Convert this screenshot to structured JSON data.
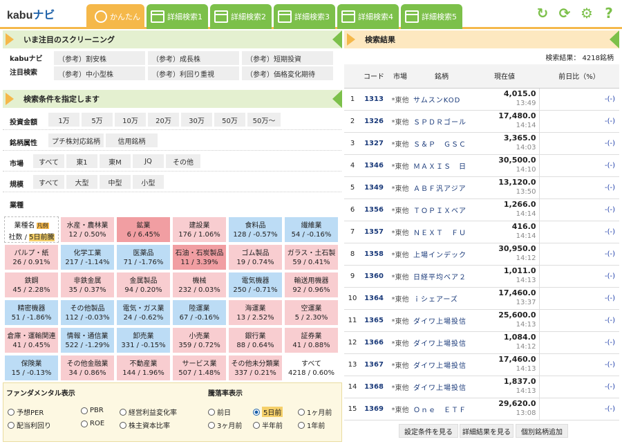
{
  "app": {
    "logo_a": "kabu",
    "logo_b": "ナビ"
  },
  "tabs": [
    {
      "label": "かんたん"
    },
    {
      "label": "詳細検索1"
    },
    {
      "label": "詳細検索2"
    },
    {
      "label": "詳細検索3"
    },
    {
      "label": "詳細検索4"
    },
    {
      "label": "詳細検索5"
    }
  ],
  "top_icons": [
    "reload-icon",
    "refresh-icon",
    "gear-icon",
    "help-icon"
  ],
  "screening": {
    "title": "いま注目のスクリーニング",
    "label1": "kabuナビ",
    "label2": "注目検索",
    "items": [
      "（参考）割安株",
      "（参考）成長株",
      "（参考）短期投資",
      "（参考）中小型株",
      "（参考）利回り重視",
      "（参考）価格変化期待"
    ]
  },
  "conditions": {
    "title": "検索条件を指定します",
    "amount_label": "投資金額",
    "amounts": [
      "1万",
      "5万",
      "10万",
      "20万",
      "30万",
      "50万",
      "50万〜"
    ],
    "attr_label": "銘柄属性",
    "attrs": [
      "プチ株対応銘柄",
      "信用銘柄"
    ],
    "market_label": "市場",
    "markets": [
      "すべて",
      "東1",
      "東M",
      "JQ",
      "その他"
    ],
    "scale_label": "規模",
    "scales": [
      "すべて",
      "大型",
      "中型",
      "小型"
    ],
    "industry_label": "業種",
    "legend": {
      "name": "業種名",
      "badge": "凡例",
      "count": "社数",
      "period": "5日前騰"
    },
    "industries": [
      {
        "name": "水産・農林業",
        "value": "12 / 0.50%",
        "color": "pk"
      },
      {
        "name": "鉱業",
        "value": "6 / 6.45%",
        "color": "dpk"
      },
      {
        "name": "建設業",
        "value": "176 / 1.06%",
        "color": "pk"
      },
      {
        "name": "食料品",
        "value": "128 / -0.57%",
        "color": "bl"
      },
      {
        "name": "繊維業",
        "value": "54 / -0.16%",
        "color": "bl"
      },
      {
        "name": "パルプ・紙",
        "value": "26 / 0.91%",
        "color": "pk"
      },
      {
        "name": "化学工業",
        "value": "217 / -1.14%",
        "color": "bl"
      },
      {
        "name": "医薬品",
        "value": "71 / -1.76%",
        "color": "bl"
      },
      {
        "name": "石油・石炭製品",
        "value": "11 / 3.39%",
        "color": "dpk"
      },
      {
        "name": "ゴム製品",
        "value": "19 / 0.74%",
        "color": "pk"
      },
      {
        "name": "ガラス・土石製",
        "value": "59 / 0.41%",
        "color": "pk"
      },
      {
        "name": "鉄鋼",
        "value": "45 / 2.28%",
        "color": "pk"
      },
      {
        "name": "非鉄金属",
        "value": "35 / 0.37%",
        "color": "pk"
      },
      {
        "name": "金属製品",
        "value": "94 / 0.20%",
        "color": "pk"
      },
      {
        "name": "機械",
        "value": "232 / 0.03%",
        "color": "pk"
      },
      {
        "name": "電気機器",
        "value": "250 / -0.71%",
        "color": "bl"
      },
      {
        "name": "輸送用機器",
        "value": "92 / 0.96%",
        "color": "pk"
      },
      {
        "name": "精密機器",
        "value": "51 / -1.86%",
        "color": "bl"
      },
      {
        "name": "その他製品",
        "value": "112 / -0.03%",
        "color": "bl"
      },
      {
        "name": "電気・ガス業",
        "value": "24 / -0.62%",
        "color": "bl"
      },
      {
        "name": "陸運業",
        "value": "67 / -0.16%",
        "color": "bl"
      },
      {
        "name": "海運業",
        "value": "13 / 2.52%",
        "color": "pk"
      },
      {
        "name": "空運業",
        "value": "5 / 2.30%",
        "color": "pk"
      },
      {
        "name": "倉庫・運輸関連",
        "value": "41 / 0.45%",
        "color": "pk"
      },
      {
        "name": "情報・通信業",
        "value": "522 / -1.29%",
        "color": "bl"
      },
      {
        "name": "卸売業",
        "value": "331 / -0.15%",
        "color": "bl"
      },
      {
        "name": "小売業",
        "value": "359 / 0.72%",
        "color": "pk"
      },
      {
        "name": "銀行業",
        "value": "88 / 0.64%",
        "color": "pk"
      },
      {
        "name": "証券業",
        "value": "41 / 0.88%",
        "color": "pk"
      },
      {
        "name": "保険業",
        "value": "15 / -0.13%",
        "color": "bl"
      },
      {
        "name": "その他金融業",
        "value": "34 / 0.86%",
        "color": "pk"
      },
      {
        "name": "不動産業",
        "value": "144 / 1.96%",
        "color": "pk"
      },
      {
        "name": "サービス業",
        "value": "507 / 1.48%",
        "color": "pk"
      },
      {
        "name": "その他未分類業",
        "value": "337 / 0.21%",
        "color": "pk"
      },
      {
        "name": "すべて",
        "value": "4218 / 0.60%",
        "color": "wh"
      }
    ]
  },
  "fund": {
    "title": "ファンダメンタル表示",
    "items": [
      "予想PER",
      "PBR",
      "経営利益変化率",
      "配当利回り",
      "ROE",
      "株主資本比率"
    ],
    "rate_title": "騰落率表示",
    "rates": [
      "前日",
      "5日前",
      "1ヶ月前",
      "3ヶ月前",
      "半年前",
      "1年前"
    ],
    "rate_selected": "5日前"
  },
  "results": {
    "title": "検索結果",
    "count": "検索結果： 4218銘柄",
    "headers": [
      "コード",
      "市場",
      "銘柄",
      "現在値",
      "前日比（%）"
    ],
    "rows": [
      {
        "no": "1",
        "code": "1313",
        "market": "*東他",
        "name": "サムスンKOD",
        "price": "4,015.0",
        "time": "13:49",
        "chg": "-(-)"
      },
      {
        "no": "2",
        "code": "1326",
        "market": "*東他",
        "name": "ＳＰＤＲゴール",
        "price": "17,480.0",
        "time": "14:14",
        "chg": "-(-)"
      },
      {
        "no": "3",
        "code": "1327",
        "market": "*東他",
        "name": "Ｓ＆Ｐ　ＧＳＣ",
        "price": "3,365.0",
        "time": "14:03",
        "chg": "-(-)"
      },
      {
        "no": "4",
        "code": "1346",
        "market": "*東他",
        "name": "ＭＡＸＩＳ　日",
        "price": "30,500.0",
        "time": "14:10",
        "chg": "-(-)"
      },
      {
        "no": "5",
        "code": "1349",
        "market": "*東他",
        "name": "ＡＢＦ汎アジア",
        "price": "13,120.0",
        "time": "13:50",
        "chg": "-(-)"
      },
      {
        "no": "6",
        "code": "1356",
        "market": "*東他",
        "name": "ＴＯＰＩＸベア",
        "price": "1,266.0",
        "time": "14:14",
        "chg": "-(-)"
      },
      {
        "no": "7",
        "code": "1357",
        "market": "*東他",
        "name": "ＮＥＸＴ　ＦＵ",
        "price": "416.0",
        "time": "14:14",
        "chg": "-(-)"
      },
      {
        "no": "8",
        "code": "1358",
        "market": "*東他",
        "name": "上場インデック",
        "price": "30,950.0",
        "time": "14:12",
        "chg": "-(-)"
      },
      {
        "no": "9",
        "code": "1360",
        "market": "*東他",
        "name": "日経平均ベア２",
        "price": "1,011.0",
        "time": "14:13",
        "chg": "-(-)"
      },
      {
        "no": "10",
        "code": "1364",
        "market": "*東他",
        "name": "ｉシェアーズ",
        "price": "17,460.0",
        "time": "13:37",
        "chg": "-(-)"
      },
      {
        "no": "11",
        "code": "1365",
        "market": "*東他",
        "name": "ダイワ上場投信",
        "price": "25,600.0",
        "time": "14:13",
        "chg": "-(-)"
      },
      {
        "no": "12",
        "code": "1366",
        "market": "*東他",
        "name": "ダイワ上場投信",
        "price": "1,084.0",
        "time": "14:12",
        "chg": "-(-)"
      },
      {
        "no": "13",
        "code": "1367",
        "market": "*東他",
        "name": "ダイワ上場投信",
        "price": "17,460.0",
        "time": "14:13",
        "chg": "-(-)"
      },
      {
        "no": "14",
        "code": "1368",
        "market": "*東他",
        "name": "ダイワ上場投信",
        "price": "1,837.0",
        "time": "14:13",
        "chg": "-(-)"
      },
      {
        "no": "15",
        "code": "1369",
        "market": "*東他",
        "name": "Ｏｎｅ　ＥＴＦ",
        "price": "29,620.0",
        "time": "13:08",
        "chg": "-(-)"
      }
    ],
    "buttons": [
      "設定条件を見る",
      "詳細結果を見る",
      "個別銘柄追加"
    ]
  }
}
